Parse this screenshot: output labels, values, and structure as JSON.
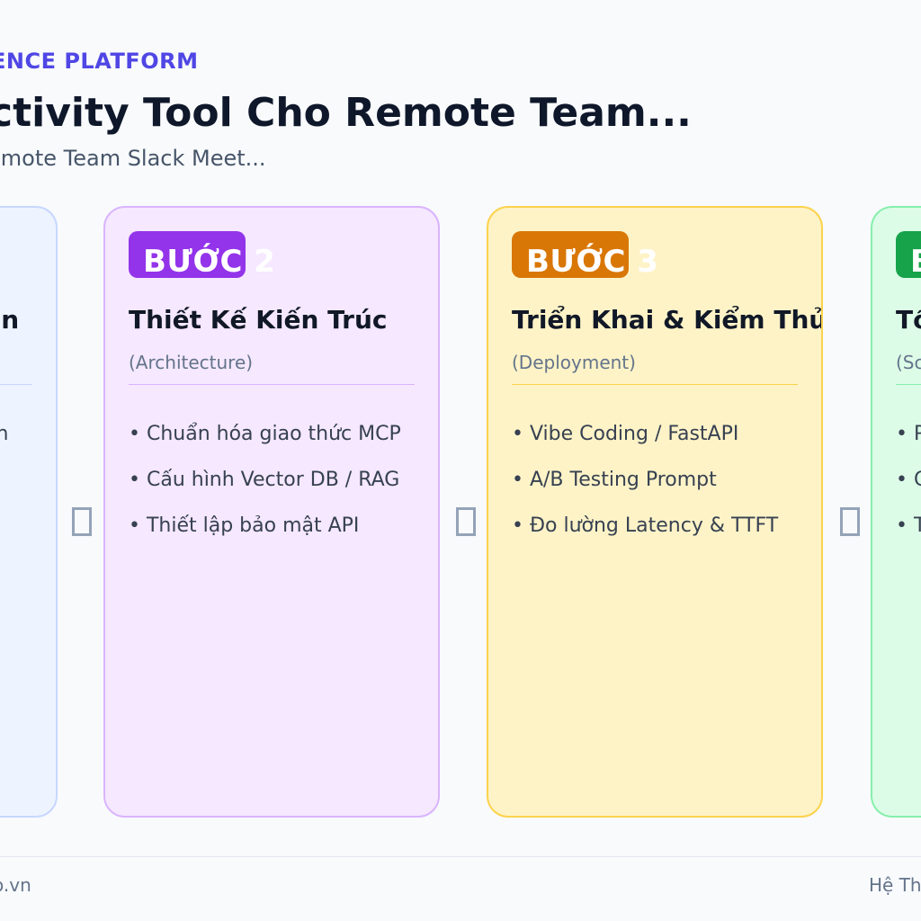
{
  "header": {
    "eyebrow": "ENCE PLATFORM",
    "title": "ctivity Tool Cho Remote Team...",
    "subtitle": "emote Team Slack Meet..."
  },
  "colors": {
    "accent": "#4f46e5",
    "step1": "#3b82f6",
    "step2": "#9333ea",
    "step3": "#d97706",
    "step4": "#16a34a"
  },
  "cards": [
    {
      "title": "ọn",
      "subtitle": "",
      "items": [
        "án"
      ]
    },
    {
      "badge": "BƯỚC 2",
      "title": "Thiết Kế Kiến Trúc",
      "subtitle": "(Architecture)",
      "items": [
        "• Chuẩn hóa giao thức MCP",
        "• Cấu hình Vector DB / RAG",
        "• Thiết lập bảo mật API"
      ]
    },
    {
      "badge": "BƯỚC 3",
      "title": "Triển Khai & Kiểm Thử",
      "subtitle": "(Deployment)",
      "items": [
        "• Vibe Coding / FastAPI",
        "• A/B Testing Prompt",
        "• Đo lường Latency & TTFT"
      ]
    },
    {
      "badge": "B",
      "title": "Tố",
      "subtitle": "(Sc",
      "items": [
        "• P",
        "• G",
        "• T"
      ]
    }
  ],
  "arrows": [
    "arrow-right-icon",
    "arrow-right-icon",
    "arrow-right-icon"
  ],
  "footer": {
    "left": "o.vn",
    "right": "Hệ Th"
  }
}
